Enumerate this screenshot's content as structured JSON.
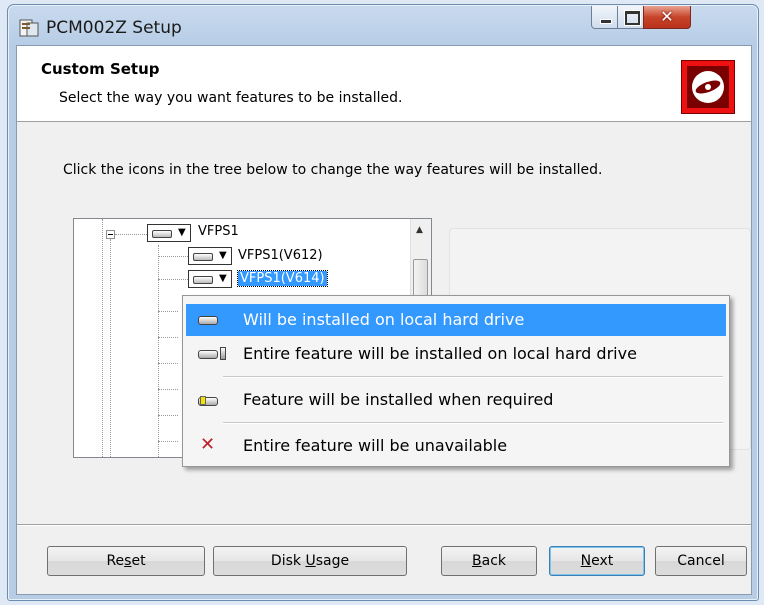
{
  "window": {
    "title": "PCM002Z Setup"
  },
  "header": {
    "title": "Custom Setup",
    "subtitle": "Select the way you want features to be installed."
  },
  "instructions": "Click the icons in the tree below to change the way features will be installed.",
  "tree": {
    "nodes": [
      {
        "label": "VFPS1",
        "selected": false
      },
      {
        "label": "VFPS1(V612)",
        "selected": false
      },
      {
        "label": "VFPS1(V614)",
        "selected": true
      }
    ]
  },
  "context_menu": {
    "items": [
      {
        "label": "Will be installed on local hard drive",
        "icon": "hard-drive-icon",
        "highlighted": true
      },
      {
        "label": "Entire feature will be installed on local hard drive",
        "icon": "hard-drive-entire-icon",
        "highlighted": false
      },
      {
        "label": "Feature will be installed when required",
        "icon": "install-on-demand-icon",
        "highlighted": false
      },
      {
        "label": "Entire feature will be unavailable",
        "icon": "unavailable-x-icon",
        "highlighted": false
      }
    ]
  },
  "buttons": {
    "reset_pre": "Re",
    "reset_key": "s",
    "reset_post": "et",
    "disk_pre": "Disk ",
    "disk_key": "U",
    "disk_post": "sage",
    "back_pre": "",
    "back_key": "B",
    "back_post": "ack",
    "next_pre": "",
    "next_key": "N",
    "next_post": "ext",
    "cancel": "Cancel"
  },
  "colors": {
    "highlight": "#3399ff",
    "logo_red": "#e11111",
    "unavailable_x": "#c0202a"
  }
}
